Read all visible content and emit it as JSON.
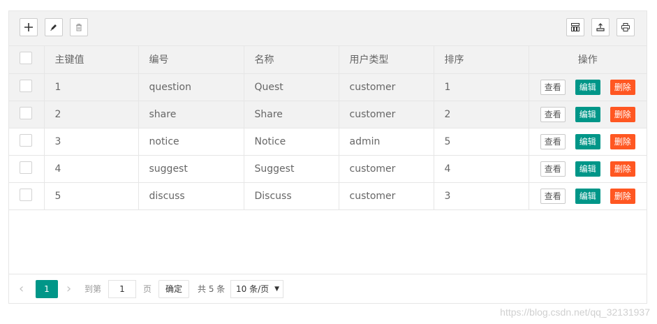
{
  "toolbar": {
    "left_icons": [
      "add-icon",
      "edit-pencil-icon",
      "delete-trash-icon"
    ],
    "right_icons": [
      "columns-filter-icon",
      "export-icon",
      "print-icon"
    ]
  },
  "table": {
    "columns": [
      "主键值",
      "编号",
      "名称",
      "用户类型",
      "排序",
      "操作"
    ],
    "rows": [
      {
        "id": "1",
        "code": "question",
        "name": "Quest",
        "user_type": "customer",
        "sort": "1"
      },
      {
        "id": "2",
        "code": "share",
        "name": "Share",
        "user_type": "customer",
        "sort": "2"
      },
      {
        "id": "3",
        "code": "notice",
        "name": "Notice",
        "user_type": "admin",
        "sort": "5"
      },
      {
        "id": "4",
        "code": "suggest",
        "name": "Suggest",
        "user_type": "customer",
        "sort": "4"
      },
      {
        "id": "5",
        "code": "discuss",
        "name": "Discuss",
        "user_type": "customer",
        "sort": "3"
      }
    ],
    "actions": {
      "view": "查看",
      "edit": "编辑",
      "delete": "删除"
    }
  },
  "pager": {
    "current_page": "1",
    "goto_label": "到第",
    "goto_value": "1",
    "page_suffix": "页",
    "confirm_label": "确定",
    "total_label": "共 5 条",
    "page_size": "10 条/页"
  },
  "colors": {
    "primary": "#009688",
    "danger": "#ff5722",
    "header_bg": "#f2f2f2",
    "border": "#e6e6e6"
  },
  "watermark": "https://blog.csdn.net/qq_32131937"
}
